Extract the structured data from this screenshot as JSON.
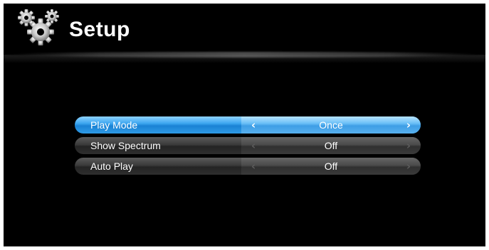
{
  "header": {
    "title": "Setup",
    "icon": "gears-icon"
  },
  "menu": {
    "items": [
      {
        "label": "Play Mode",
        "value": "Once",
        "selected": true,
        "left_arrow": "‹",
        "right_arrow": "›"
      },
      {
        "label": "Show Spectrum",
        "value": "Off",
        "selected": false,
        "left_arrow": "‹",
        "right_arrow": "›"
      },
      {
        "label": "Auto Play",
        "value": "Off",
        "selected": false,
        "left_arrow": "‹",
        "right_arrow": "›"
      }
    ]
  },
  "colors": {
    "background": "#000000",
    "highlight": "#3ea7f0",
    "row": "#3a3a3a",
    "text": "#ffffff"
  }
}
